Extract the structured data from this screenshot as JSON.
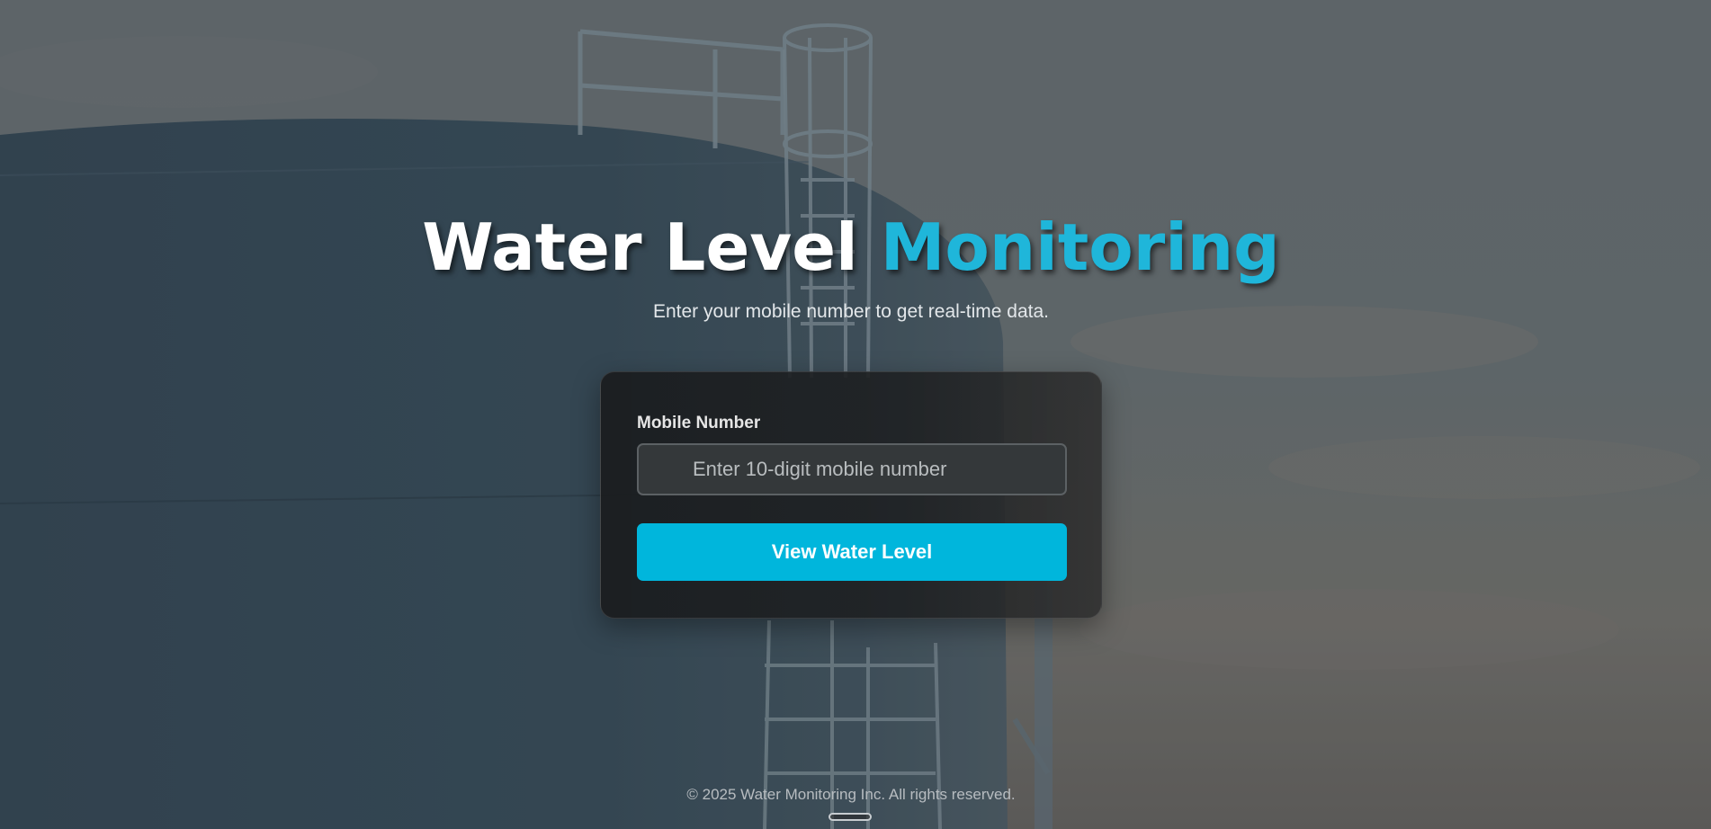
{
  "hero": {
    "title_main": "Water Level ",
    "title_accent": "Monitoring",
    "subtitle": "Enter your mobile number to get real-time data."
  },
  "form": {
    "label": "Mobile Number",
    "input_value": "",
    "input_placeholder": "Enter 10-digit mobile number",
    "submit_label": "View Water Level"
  },
  "footer": {
    "text": "© 2025 Water Monitoring Inc. All rights reserved."
  },
  "colors": {
    "accent": "#00b6dc",
    "card_bg": "#1c1e20",
    "text_light": "#ffffff"
  },
  "icons": {
    "input_icon": "phone-icon"
  }
}
